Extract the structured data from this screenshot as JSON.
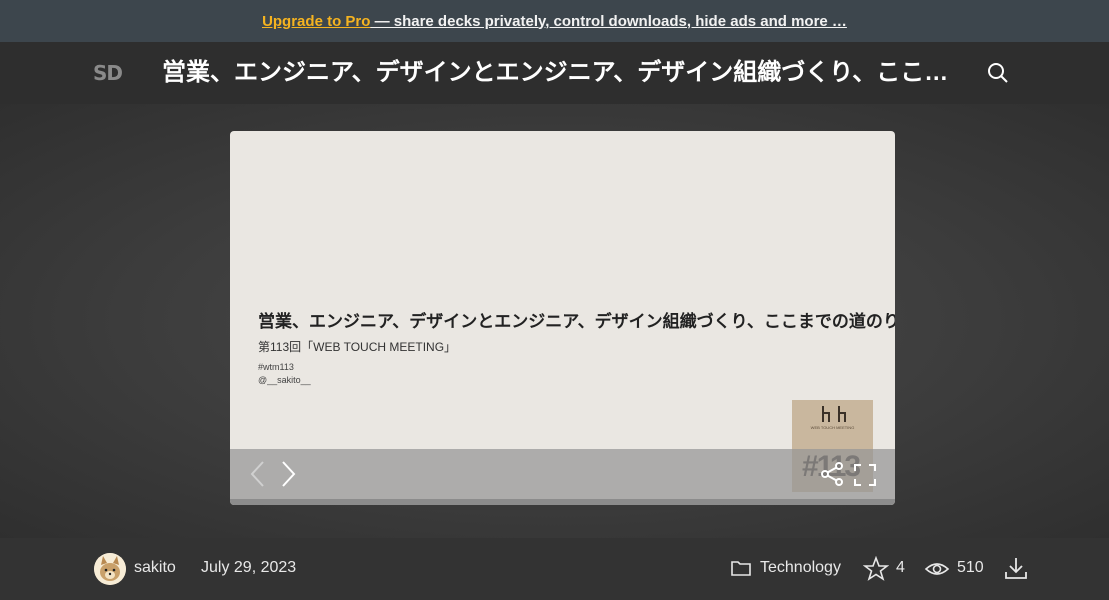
{
  "banner": {
    "pro_label": "Upgrade to Pro",
    "text": " — share decks privately, control downloads, hide ads and more …"
  },
  "header": {
    "logo": "SD",
    "title": "営業、エンジニア、デザインとエンジニア、デザイン組織づくり、ここまでの道のり",
    "search_icon": "search-icon"
  },
  "slide": {
    "title": "営業、エンジニア、デザインとエンジニア、デザイン組織づくり、ここまでの道のり",
    "subtitle": "第113回「WEB TOUCH MEETING」",
    "hashtag": "#wtm113",
    "handle": "@__sakito__",
    "thumb_caption": "WEB TOUCH MEETING",
    "thumb_number": "#113",
    "progress": 0.0
  },
  "footer": {
    "author": "sakito",
    "date": "July 29, 2023",
    "category": "Technology",
    "stars": "4",
    "views": "510"
  },
  "colors": {
    "banner_bg": "#3d464d",
    "pro_accent": "#f5b320",
    "header_bg": "#2e2e2e",
    "slide_bg": "#eae7e2",
    "footer_bg": "#333333"
  }
}
